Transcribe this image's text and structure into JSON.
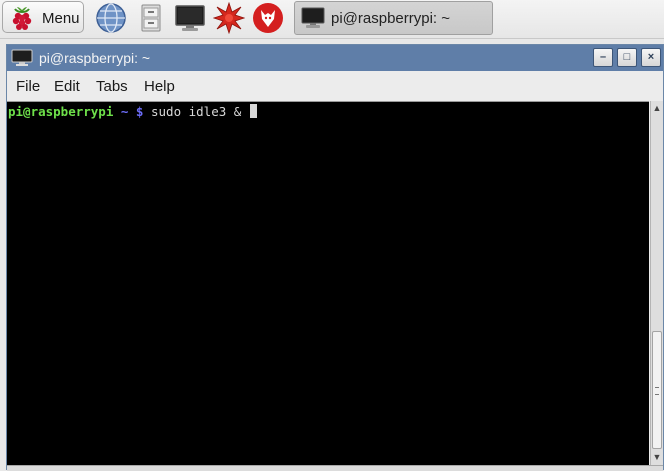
{
  "taskbar": {
    "menu_label": "Menu",
    "launchers": [
      {
        "icon": "web-browser-globe-icon"
      },
      {
        "icon": "file-manager-cabinet-icon"
      },
      {
        "icon": "terminal-monitor-icon"
      },
      {
        "icon": "math-kernel-starburst-icon"
      },
      {
        "icon": "wolfram-wolf-icon"
      }
    ],
    "active_task": {
      "label": "pi@raspberrypi: ~",
      "icon": "terminal-icon"
    }
  },
  "window": {
    "title": "pi@raspberrypi: ~",
    "controls": {
      "minimize": "–",
      "maximize": "□",
      "close": "×"
    },
    "menu": [
      "File",
      "Edit",
      "Tabs",
      "Help"
    ]
  },
  "terminal": {
    "prompt_user": "pi@raspberrypi",
    "prompt_path": " ~ $",
    "command": " sudo idle3 & "
  },
  "colors": {
    "titlebar": "#5f7ea8",
    "prompt_user": "#6ee04a",
    "prompt_path": "#6c6cf8",
    "terminal_bg": "#000000"
  }
}
